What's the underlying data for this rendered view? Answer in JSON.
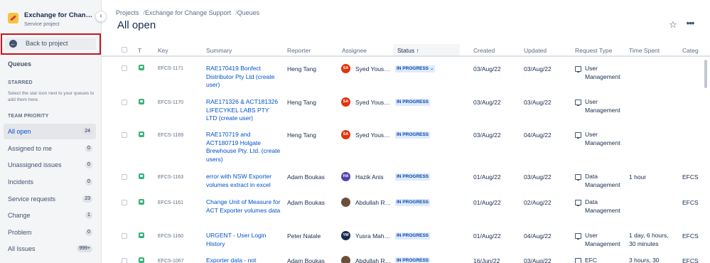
{
  "sidebar": {
    "project_name": "Exchange for Change S...",
    "project_type": "Service project",
    "back_label": "Back to project",
    "title": "Queues",
    "starred_heading": "STARRED",
    "starred_hint": "Select the star icon next to your queues to add them here.",
    "team_heading": "TEAM PRIORITY",
    "queues": [
      {
        "label": "All open",
        "count": "24",
        "active": true
      },
      {
        "label": "Assigned to me",
        "count": "0"
      },
      {
        "label": "Unassigned issues",
        "count": "0"
      },
      {
        "label": "Incidents",
        "count": "0"
      },
      {
        "label": "Service requests",
        "count": "23"
      },
      {
        "label": "Change",
        "count": "1"
      },
      {
        "label": "Problem",
        "count": "0"
      },
      {
        "label": "All Issues",
        "count": "999+"
      }
    ],
    "collapse_icon": "chevron-left-icon",
    "back_icon": "arrow-left-icon"
  },
  "breadcrumb": [
    "Projects",
    "Exchange for Change Support",
    "Queues"
  ],
  "page_title": "All open",
  "actions": {
    "star_icon": "star-icon",
    "more_icon": "more-icon",
    "star_glyph": "☆",
    "more_glyph": "•••"
  },
  "table": {
    "headers": {
      "type": "T",
      "key": "Key",
      "summary": "Summary",
      "reporter": "Reporter",
      "assignee": "Assignee",
      "status": "Status",
      "status_sort": "↑",
      "created": "Created",
      "updated": "Updated",
      "request_type": "Request Type",
      "time_spent": "Time Spent",
      "category": "Categ"
    },
    "rows": [
      {
        "key": "EFCS-1171",
        "summary": "RAE170419 Bonfect Distributor Pty Ltd (create user)",
        "reporter": "Heng Tang",
        "avatar": "SA",
        "avatar_color": "#de350b",
        "assignee": "Syed Yousuf...",
        "status": "IN PROGRESS",
        "status_dropdown": "⌄",
        "created": "03/Aug/22",
        "updated": "03/Aug/22",
        "request_type": "User Management",
        "time_spent": "",
        "category": ""
      },
      {
        "key": "EFCS-1170",
        "summary": "RAE171326 & ACT181326 LIFECYKEL LABS PTY LTD (create user)",
        "reporter": "Heng Tang",
        "avatar": "SA",
        "avatar_color": "#de350b",
        "assignee": "Syed Yousuf...",
        "status": "IN PROGRESS",
        "created": "03/Aug/22",
        "updated": "03/Aug/22",
        "request_type": "User Management",
        "time_spent": "",
        "category": ""
      },
      {
        "key": "EFCS-1169",
        "summary": "RAE170719 and ACT180719 Holgate Brewhouse Pty. Ltd. (create users)",
        "reporter": "Heng Tang",
        "avatar": "SA",
        "avatar_color": "#de350b",
        "assignee": "Syed Yousuf...",
        "status": "IN PROGRESS",
        "created": "03/Aug/22",
        "updated": "04/Aug/22",
        "request_type": "User Management",
        "time_spent": "",
        "category": ""
      },
      {
        "key": "EFCS-1163",
        "summary": "error with NSW Exporter volumes extract in excel",
        "reporter": "Adam Boukas",
        "avatar": "HA",
        "avatar_color": "#5243aa",
        "assignee": "Hazik Anis",
        "status": "IN PROGRESS",
        "created": "01/Aug/22",
        "updated": "03/Aug/22",
        "request_type": "Data Management",
        "time_spent": "1 hour",
        "category": "EFCS"
      },
      {
        "key": "EFCS-1161",
        "summary": "Change Unit of Measure for ACT Exporter volumes data",
        "reporter": "Adam Boukas",
        "avatar": "",
        "avatar_color": "#6b4f3a",
        "assignee": "Abdullah Ra...",
        "status": "IN PROGRESS",
        "created": "01/Aug/22",
        "updated": "02/Aug/22",
        "request_type": "Data Management",
        "time_spent": "",
        "category": "EFCS"
      },
      {
        "key": "EFCS-1160",
        "summary": "URGENT - User Login History",
        "reporter": "Peter Natale",
        "avatar": "YM",
        "avatar_color": "#172b4d",
        "assignee": "Yusra Mahm...",
        "status": "IN PROGRESS",
        "created": "01/Aug/22",
        "updated": "04/Aug/22",
        "request_type": "User Management",
        "time_spent": "1 day, 6 hours, 30 minutes",
        "category": "EFCS"
      },
      {
        "key": "EFCS-1067",
        "summary": "Exporter data - not",
        "reporter": "Adam Boukas",
        "avatar": "",
        "avatar_color": "#6b4f3a",
        "assignee": "Abdullah Ra...",
        "status": "IN PROGRESS",
        "created": "16/Jun/22",
        "updated": "03/Aug/22",
        "request_type": "EFC",
        "time_spent": "3 hours, 30",
        "category": "EFCS"
      }
    ]
  }
}
